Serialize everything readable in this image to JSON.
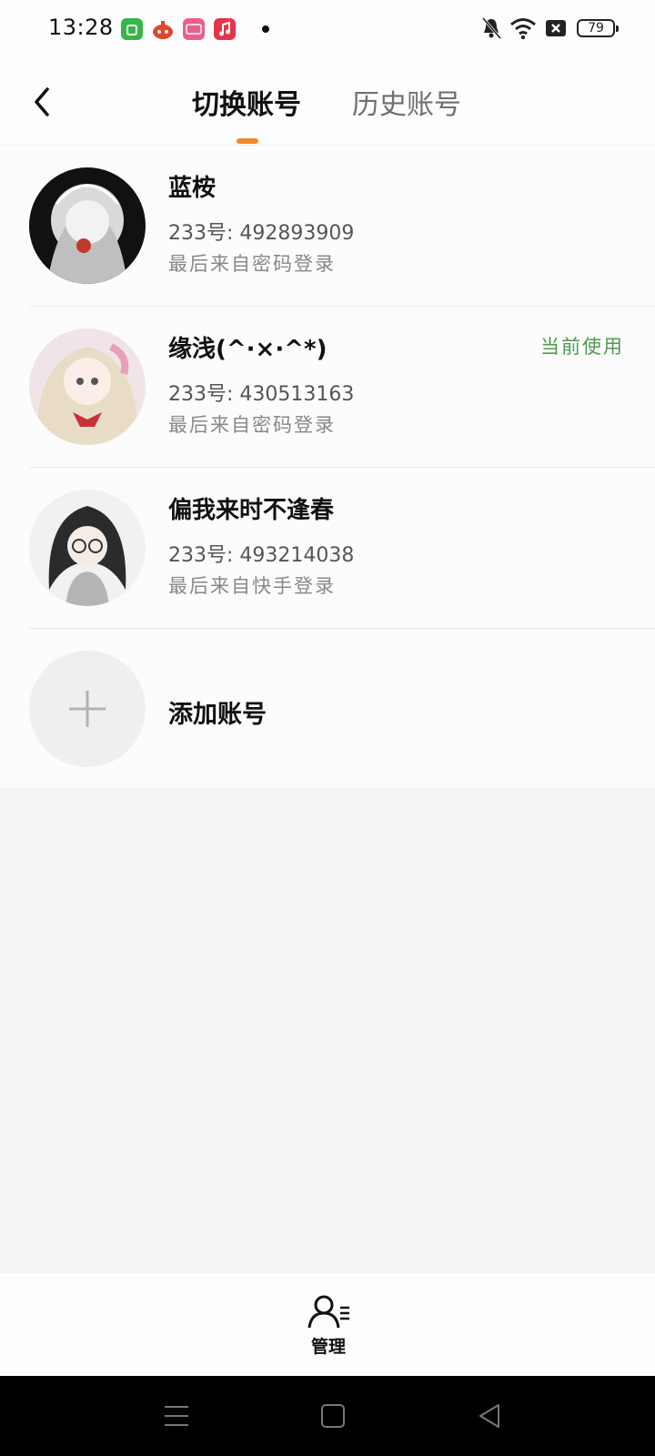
{
  "status_bar": {
    "time": "13:28",
    "battery": "79",
    "icons": [
      "app-store-icon",
      "game-icon",
      "weibo-icon",
      "music-icon",
      "notification-dot-icon",
      "mute-bell-icon",
      "wifi-icon",
      "no-sim-icon",
      "battery-icon"
    ]
  },
  "header": {
    "back_icon": "chevron-left-icon",
    "tabs": [
      {
        "label": "切换账号",
        "active": true
      },
      {
        "label": "历史账号",
        "active": false
      }
    ],
    "accent_color": "#f08a24"
  },
  "accounts": [
    {
      "name": "蓝桉",
      "id": "233号: 492893909",
      "source": "最后来自密码登录",
      "current": false
    },
    {
      "name": "缘浅(^·×·^*)",
      "id": "233号: 430513163",
      "source": "最后来自密码登录",
      "current": true,
      "current_label": "当前使用"
    },
    {
      "name": "偏我来时不逢春",
      "id": "233号: 493214038",
      "source": "最后来自快手登录",
      "current": false
    }
  ],
  "add_account": {
    "label": "添加账号",
    "icon": "plus-icon"
  },
  "bottom_bar": {
    "manage_label": "管理",
    "icon": "user-manage-icon"
  },
  "nav_bar": {
    "icons": [
      "menu-icon",
      "home-icon",
      "back-triangle-icon"
    ]
  },
  "colors": {
    "current_tag": "#4f9a4f",
    "page_bg": "#f4f3f6"
  }
}
